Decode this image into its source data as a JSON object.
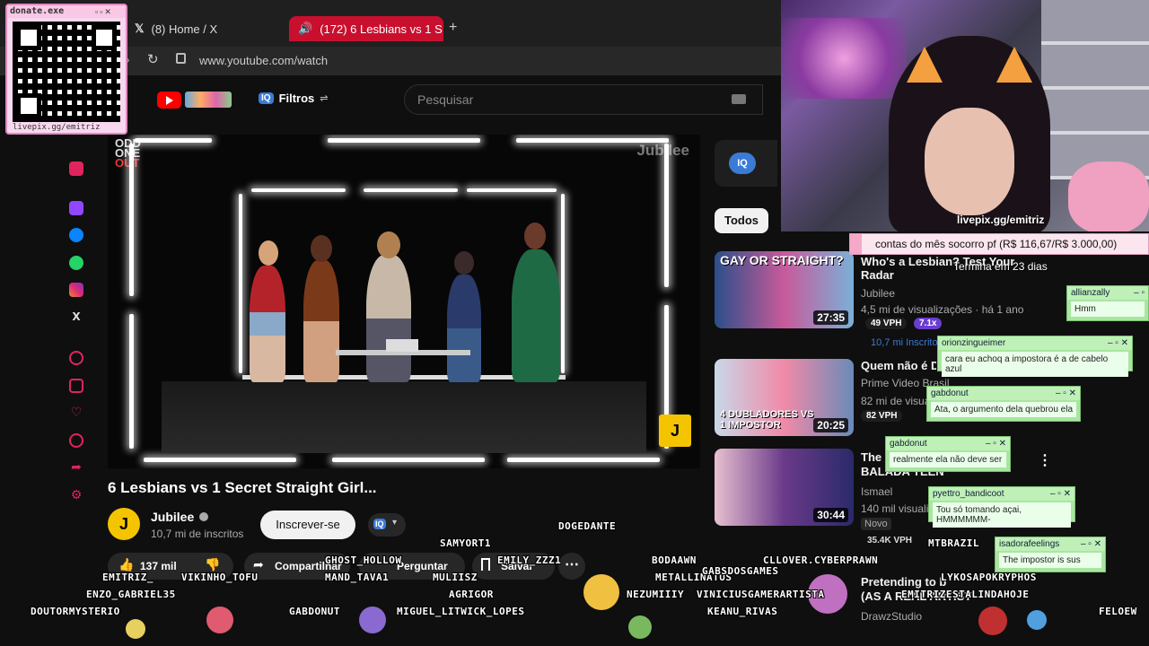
{
  "browser": {
    "tabs": [
      {
        "label": "(8) Home / X"
      },
      {
        "label": "(172) 6 Lesbians vs 1 S"
      }
    ],
    "new_tab_label": "+",
    "url": "www.youtube.com/watch"
  },
  "youtube": {
    "filter_label": "Filtros",
    "search_placeholder": "Pesquisar",
    "video_watermark": "Jubilee",
    "odd_one_out_lines": [
      "ODD",
      "ONE",
      "OUT"
    ],
    "video_title": "6 Lesbians vs 1 Secret Straight Girl...",
    "channel_name": "Jubilee",
    "subscribers": "10,7 mi de inscritos",
    "subscribe_label": "Inscrever-se",
    "likes": "137 mil",
    "share_label": "Compartilhar",
    "ask_label": "Perguntar",
    "save_label": "Salvar",
    "chip_all": "Todos",
    "recommendations": [
      {
        "title": "Who's a Lesbian? Test Your",
        "title2": "Radar",
        "channel": "Jubilee",
        "views": "4,5 mi de visualizações · há 1 ano",
        "vph": "49 VPH",
        "badge": "7.1x",
        "subs": "10,7 mi Inscritos",
        "duration": "27:35",
        "thumb_text": "GAY OR STRAIGHT?"
      },
      {
        "title": "Quem não é D",
        "channel": "Prime Video Brasil",
        "views": "82 mi de visualizações",
        "vph": "82 VPH",
        "duration": "20:25",
        "thumb_text": "4 DUBLADORES VS 1 IMPOSTOR"
      },
      {
        "title": "The",
        "title2": "BALADA TEEN",
        "channel": "Ismael",
        "views": "140 mil visualizações",
        "new": "Novo",
        "vph": "35.4K VPH",
        "duration": "30:44"
      },
      {
        "title": "Pretending to b",
        "title2": "(AS A REAL ARTIST",
        "channel": "DrawzStudio"
      }
    ]
  },
  "overlay": {
    "donate_title": "donate.exe",
    "donate_url": "livepix.gg/emitriz",
    "cam_url": "livepix.gg/emitriz",
    "goal_text": "contas do mês socorro pf (R$ 116,67/R$ 3.000,00)",
    "goal_ends": "Termina em 23 dias",
    "chat_messages": [
      {
        "user": "allianzally",
        "text": "Hmm"
      },
      {
        "user": "orionzingueimer",
        "text": "cara eu achoq a impostora é a de cabelo azul"
      },
      {
        "user": "gabdonut",
        "text": "Ata, o argumento dela quebrou ela"
      },
      {
        "user": "gabdonut",
        "text": "realmente ela não deve ser"
      },
      {
        "user": "pyettro_bandicoot",
        "text": "Tou só tomando açai, HMMMMMM-"
      },
      {
        "user": "isadorafeelings",
        "text": "The impostor is sus"
      }
    ],
    "chatters": [
      "DOGEDANTE",
      "SAMYORT1",
      "GHOST_HOLLOW",
      "EMILY_ZZZ1",
      "BODAAWN",
      "CLLOVER.CYBERPRAWN",
      "EMITRIZ_",
      "VIKINHO_TOFU",
      "MAND_TAVA1",
      "MULIISZ",
      "METALLINATUS",
      "GABSDOSGAMES",
      "MTBRAZIL",
      "LYKOSAPOKRYPHOS",
      "ENZO_GABRIEL35",
      "AGRIGOR",
      "NEZUMIIIY",
      "VINICIUSGAMERARTISTA",
      "EMITRIZESTALINDAHOJE",
      "DOUTORMYSTERIO",
      "GABDONUT",
      "MIGUEL_LITWICK_LOPES",
      "KEANU_RIVAS",
      "FELOEW"
    ]
  }
}
